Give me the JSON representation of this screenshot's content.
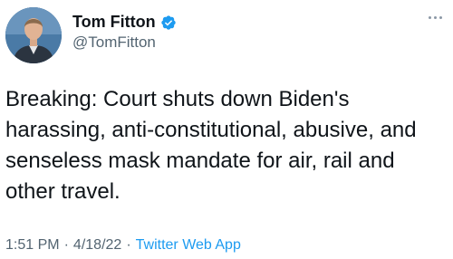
{
  "author": {
    "display_name": "Tom Fitton",
    "handle": "@TomFitton",
    "verified": true
  },
  "tweet": {
    "text": "Breaking: Court shuts down Biden's harassing, anti-constitutional, abusive, and senseless mask mandate for air, rail and other travel.",
    "time": "1:51 PM",
    "date": "4/18/22",
    "separator": "·",
    "source": "Twitter Web App"
  },
  "icons": {
    "verified": "verified-badge-icon",
    "more": "more-options-icon"
  },
  "colors": {
    "accent": "#1d9bf0",
    "text": "#0f1419",
    "secondary": "#536471"
  }
}
